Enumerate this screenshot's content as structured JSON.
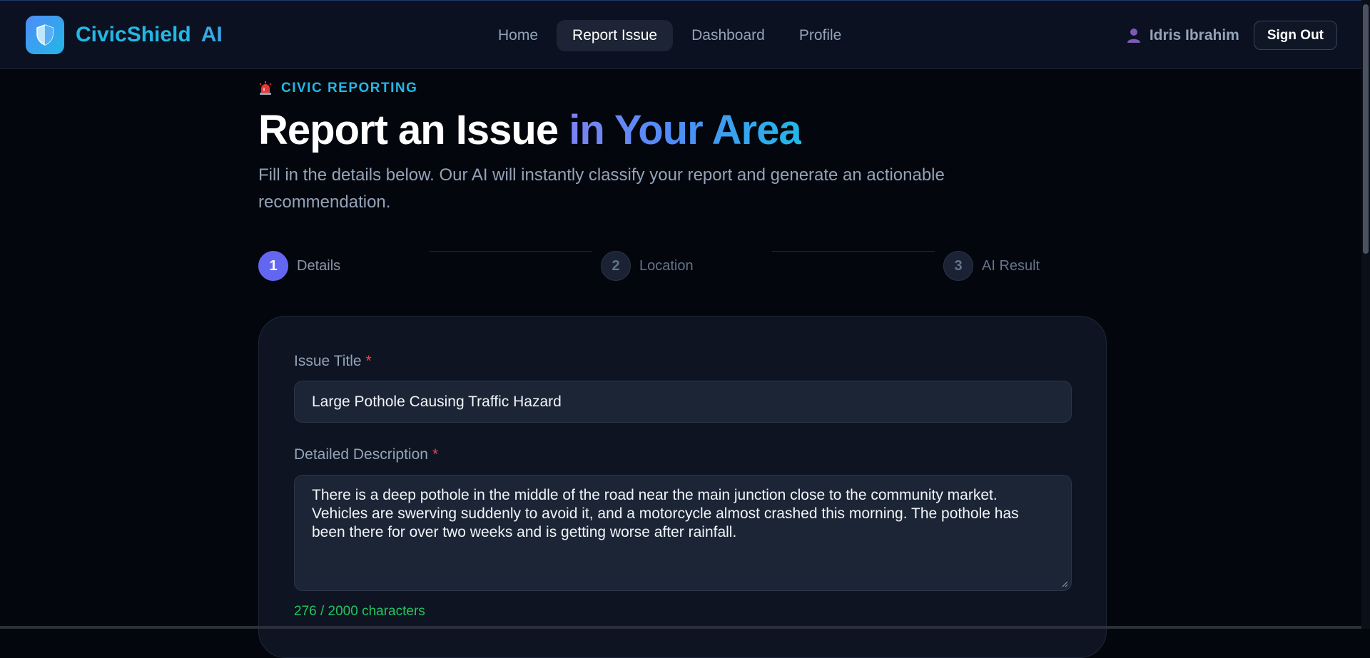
{
  "brand": {
    "name": "CivicShield",
    "suffix": "AI",
    "logo_icon": "shield-icon"
  },
  "nav": {
    "items": [
      {
        "label": "Home",
        "active": false
      },
      {
        "label": "Report Issue",
        "active": true
      },
      {
        "label": "Dashboard",
        "active": false
      },
      {
        "label": "Profile",
        "active": false
      }
    ]
  },
  "user": {
    "name": "Idris Ibrahim",
    "icon": "user-icon",
    "sign_out_label": "Sign Out"
  },
  "page": {
    "eyebrow": "CIVIC REPORTING",
    "eyebrow_icon": "siren-icon",
    "title_main": "Report an Issue",
    "title_highlight": "in Your Area",
    "subtitle": "Fill in the details below. Our AI will instantly classify your report and generate an actionable recommendation."
  },
  "steps": [
    {
      "number": "1",
      "label": "Details",
      "active": true
    },
    {
      "number": "2",
      "label": "Location",
      "active": false
    },
    {
      "number": "3",
      "label": "AI Result",
      "active": false
    }
  ],
  "form": {
    "required_marker": "*",
    "issue_title": {
      "label": "Issue Title",
      "value": "Large Pothole Causing Traffic Hazard"
    },
    "description": {
      "label": "Detailed Description",
      "value": "There is a deep pothole in the middle of the road near the main junction close to the community market. Vehicles are swerving suddenly to avoid it, and a motorcycle almost crashed this morning. The pothole has been there for over two weeks and is getting worse after rainfall."
    },
    "char_count": "276 / 2000 characters"
  },
  "colors": {
    "background": "#04060d",
    "accent": "#22b8e6",
    "step_active": "#6366f1",
    "required": "#ef4444",
    "success": "#22c55e"
  }
}
